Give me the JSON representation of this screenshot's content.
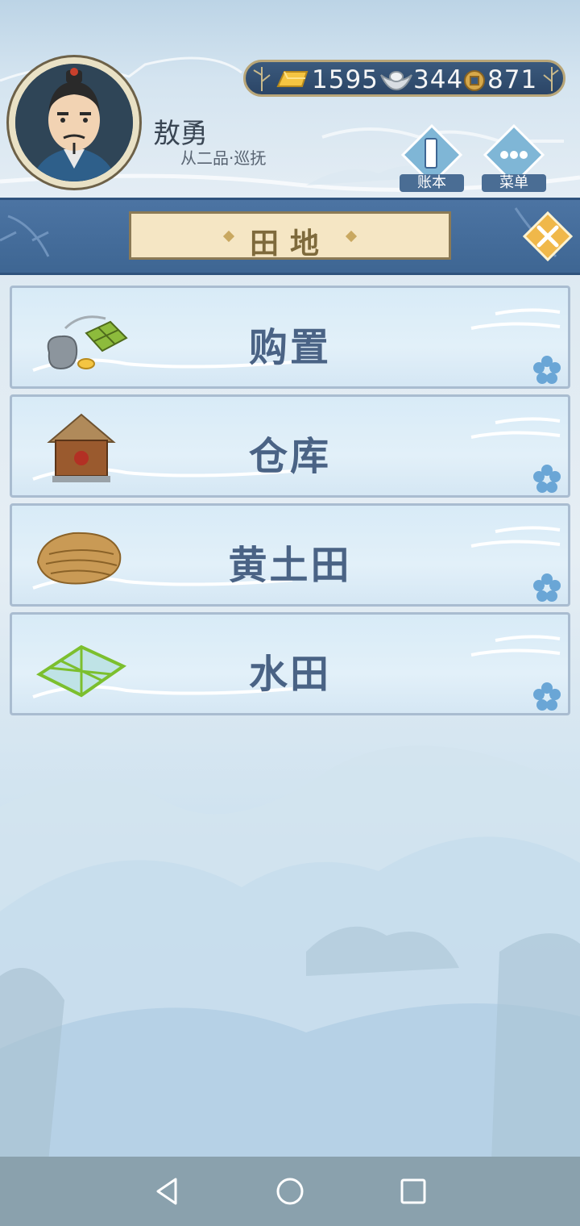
{
  "player": {
    "name": "敖勇",
    "rank": "从二品·巡抚",
    "avatar_icon": "official-portrait-icon"
  },
  "currency": {
    "gold": "1595",
    "silver": "344",
    "coin": "871",
    "gold_icon": "gold-bar-icon",
    "silver_icon": "silver-ingot-icon",
    "coin_icon": "copper-coin-icon"
  },
  "top_buttons": {
    "ledger_label": "账本",
    "menu_label": "菜单"
  },
  "panel": {
    "title": "田地",
    "close_icon": "close-icon"
  },
  "items": [
    {
      "label": "购置",
      "icon": "purchase-bundle-icon"
    },
    {
      "label": "仓库",
      "icon": "granary-hut-icon"
    },
    {
      "label": "黄土田",
      "icon": "loess-field-icon"
    },
    {
      "label": "水田",
      "icon": "paddy-field-icon"
    }
  ],
  "colors": {
    "accent_blue": "#4a6385",
    "title_band": "#4c74a3",
    "plate": "#f5e6c4",
    "close": "#f0b84a"
  },
  "navbar": {
    "back_icon": "back-triangle-icon",
    "home_icon": "home-circle-icon",
    "recents_icon": "recents-square-icon"
  }
}
